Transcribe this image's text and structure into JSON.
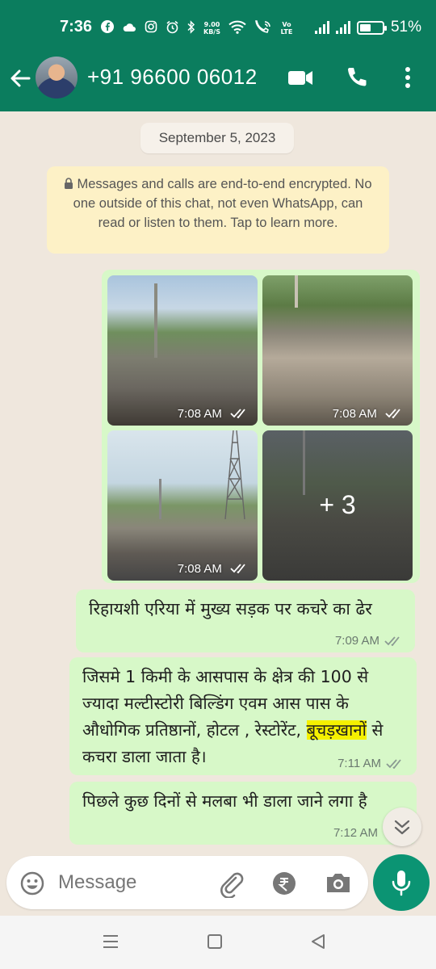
{
  "status_bar": {
    "time": "7:36",
    "network_speed_value": "9.00",
    "network_speed_unit": "KB/S",
    "volte_label": "Vo LTE",
    "battery_percent": "51%",
    "battery_level": 0.51,
    "icons": [
      "facebook-icon",
      "cloud-icon",
      "instagram-icon",
      "alarm-icon",
      "bluetooth-icon",
      "wifi-icon",
      "wifi-calling-icon",
      "signal-icon",
      "signal-icon",
      "battery-icon"
    ]
  },
  "header": {
    "contact_name": "+91 96600 06012",
    "icons": [
      "back-arrow-icon",
      "video-call-icon",
      "voice-call-icon",
      "more-vert-icon"
    ]
  },
  "chat": {
    "date_chip": "September 5, 2023",
    "encryption_notice": "Messages and calls are end-to-end encrypted. No one outside of this chat, not even WhatsApp, can read or listen to them. Tap to learn more.",
    "media_group": {
      "photos": [
        {
          "time": "7:08 AM"
        },
        {
          "time": "7:08 AM"
        },
        {
          "time": "7:08 AM"
        }
      ],
      "more_count": "+ 3"
    },
    "messages": [
      {
        "text": "रिहायशी एरिया में मुख्य सड़क पर कचरे का ढेर",
        "time": "7:09 AM"
      },
      {
        "text_before": "जिसमे 1 किमी के आसपास के क्षेत्र की 100 से ज्यादा मल्टीस्टोरी बिल्डिंग एवम आस पास के औधोगिक प्रतिष्ठानों, होटल , रेस्टोरेंट, ",
        "text_highlight": "बूचड़खानों",
        "text_after": " से कचरा डाला जाता है।",
        "time": "7:11 AM"
      },
      {
        "text": "पिछले कुछ दिनों से मलबा भी डाला जाने लगा है",
        "time": "7:12 AM"
      }
    ]
  },
  "input_bar": {
    "placeholder": "Message",
    "icons": [
      "emoji-icon",
      "attach-icon",
      "rupee-icon",
      "camera-icon",
      "mic-icon"
    ]
  },
  "colors": {
    "header_green": "#0b7d5e",
    "bubble_green": "#d7f8c8",
    "chat_bg": "#efe7dd",
    "notice_yellow": "#fdf1c6",
    "mic_green": "#0b9473",
    "highlight_yellow": "#f5f000"
  }
}
